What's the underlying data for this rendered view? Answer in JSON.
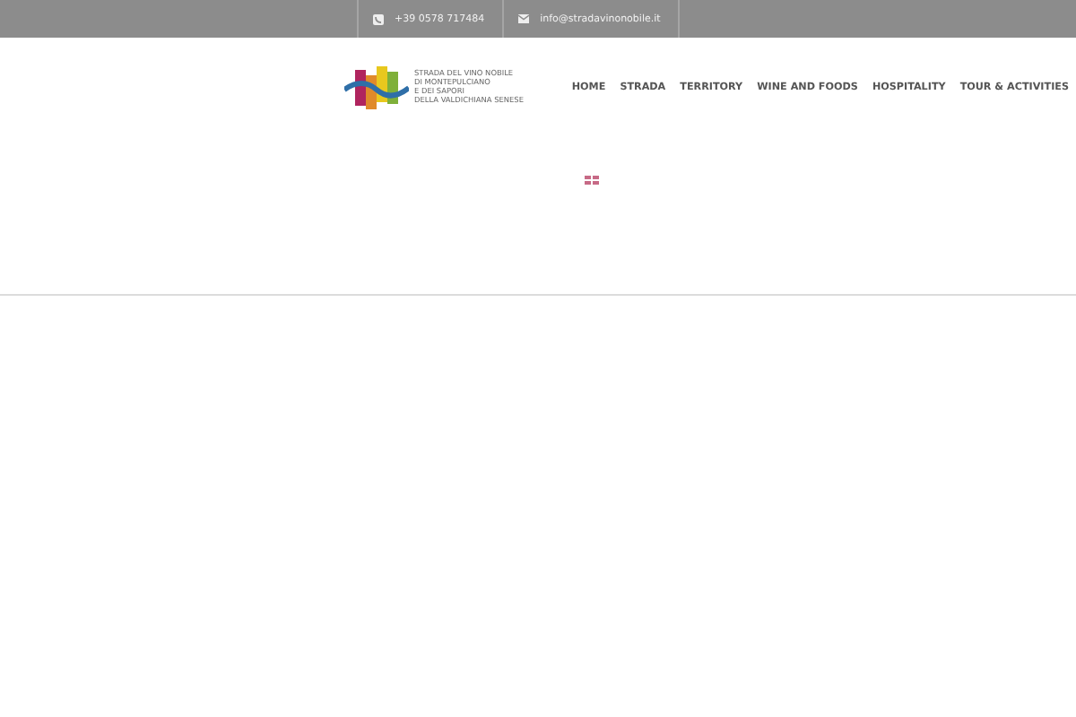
{
  "top_bar": {
    "phone": "+39 0578 717484",
    "email": "info@stradavinonobile.it"
  },
  "logo": {
    "lines": [
      "STRADA DEL VINO NOBILE",
      "DI MONTEPULCIANO",
      "E DEI SAPORI",
      "DELLA VALDICHIANA SENESE"
    ]
  },
  "nav": [
    {
      "label": "HOME"
    },
    {
      "label": "STRADA"
    },
    {
      "label": "TERRITORY"
    },
    {
      "label": "WINE AND FOODS"
    },
    {
      "label": "HOSPITALITY"
    },
    {
      "label": "TOUR & ACTIVITIES"
    }
  ]
}
